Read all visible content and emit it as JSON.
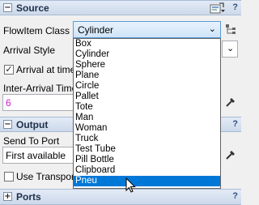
{
  "source": {
    "title": "Source",
    "help": "?",
    "toggle": "−",
    "flowitem_class_label": "FlowItem Class",
    "flowitem_class_value": "Cylinder",
    "arrival_style_label": "Arrival Style",
    "arrival_at_time_label": "Arrival at time",
    "arrival_at_time_checked": true,
    "inter_arrival_label": "Inter-Arrival Time",
    "inter_arrival_value": "6"
  },
  "output": {
    "title": "Output",
    "toggle": "−",
    "send_to_port_label": "Send To Port",
    "send_to_port_value": "First available",
    "use_transport_label": "Use Transport",
    "use_transport_checked": false
  },
  "ports": {
    "title": "Ports",
    "toggle": "+",
    "help": "?"
  },
  "dropdown": {
    "options": [
      "Box",
      "Cylinder",
      "Sphere",
      "Plane",
      "Circle",
      "Pallet",
      "Tote",
      "Man",
      "Woman",
      "Truck",
      "Test Tube",
      "Pill Bottle",
      "Clipboard",
      "Pneu"
    ],
    "highlighted": "Pneu"
  },
  "colors": {
    "accent": "#0078d7",
    "header": "#ccd9ea",
    "value_text": "#d020d0"
  }
}
